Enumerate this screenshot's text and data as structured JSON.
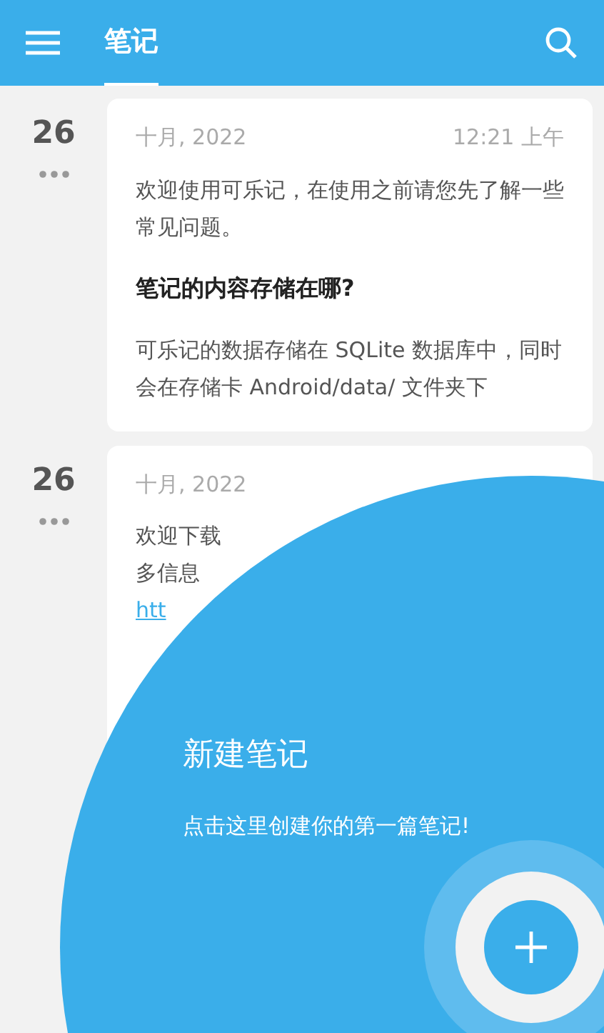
{
  "app_bar": {
    "tabs": [
      {
        "label": "笔记",
        "selected": true
      }
    ]
  },
  "notes": [
    {
      "day": "26",
      "month_year": "十月, 2022",
      "time": "12:21 上午",
      "blocks": [
        {
          "kind": "text",
          "text": "欢迎使用可乐记，在使用之前请您先了解一些常见问题。"
        },
        {
          "kind": "heading",
          "text": "笔记的内容存储在哪?"
        },
        {
          "kind": "text",
          "text": "可乐记的数据存储在 SQLite 数据库中，同时会在存储卡 Android/data/ 文件夹下"
        }
      ]
    },
    {
      "day": "26",
      "month_year": "十月, 2022",
      "blocks": [
        {
          "kind": "line",
          "text": "欢迎下载"
        },
        {
          "kind": "line",
          "text": "多信息"
        },
        {
          "kind": "link",
          "text": "htt"
        }
      ]
    }
  ],
  "onboarding": {
    "title": "新建笔记",
    "description": "点击这里创建你的第一篇笔记!"
  }
}
